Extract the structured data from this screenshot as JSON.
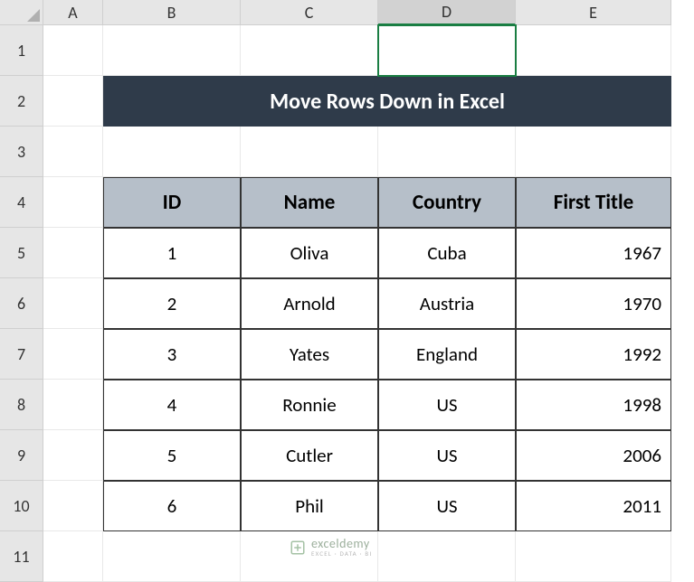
{
  "columns": [
    "A",
    "B",
    "C",
    "D",
    "E"
  ],
  "rows": [
    "1",
    "2",
    "3",
    "4",
    "5",
    "6",
    "7",
    "8",
    "9",
    "10",
    "11"
  ],
  "selected_column": "D",
  "title": "Move Rows Down in Excel",
  "table": {
    "headers": [
      "ID",
      "Name",
      "Country",
      "First Title"
    ],
    "rows": [
      {
        "id": "1",
        "name": "Oliva",
        "country": "Cuba",
        "title": "1967"
      },
      {
        "id": "2",
        "name": "Arnold",
        "country": "Austria",
        "title": "1970"
      },
      {
        "id": "3",
        "name": "Yates",
        "country": "England",
        "title": "1992"
      },
      {
        "id": "4",
        "name": "Ronnie",
        "country": "US",
        "title": "1998"
      },
      {
        "id": "5",
        "name": "Cutler",
        "country": "US",
        "title": "2006"
      },
      {
        "id": "6",
        "name": "Phil",
        "country": "US",
        "title": "2011"
      }
    ]
  },
  "watermark": {
    "main": "exceldemy",
    "sub": "EXCEL · DATA · BI"
  }
}
